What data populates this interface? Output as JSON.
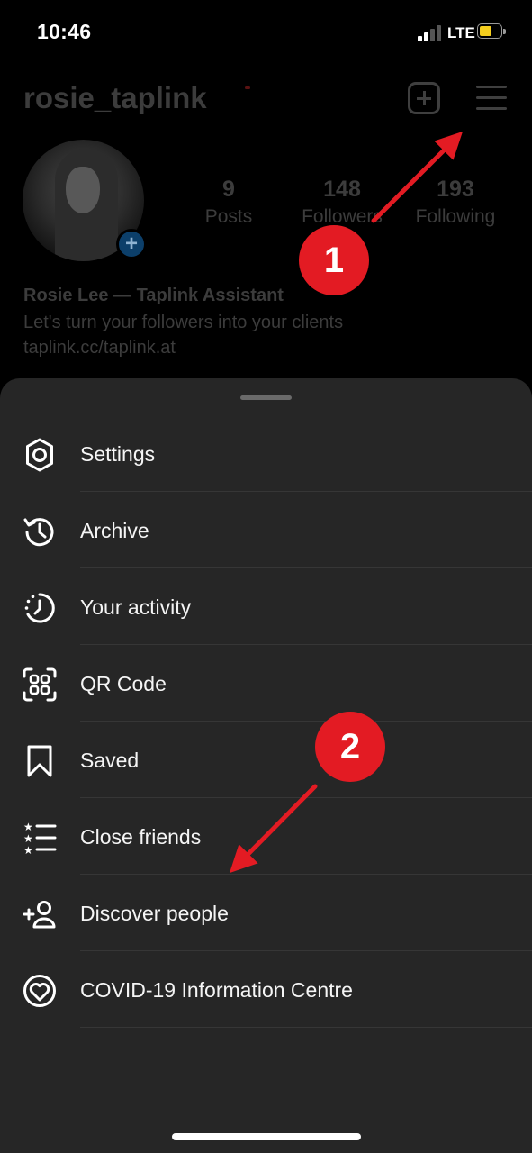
{
  "status_bar": {
    "time": "10:46",
    "network": "LTE",
    "battery_level": 0.6,
    "battery_color": "#f6cf1e"
  },
  "profile": {
    "username": "rosie_taplink",
    "stats": [
      {
        "value": "9",
        "label": "Posts"
      },
      {
        "value": "148",
        "label": "Followers"
      },
      {
        "value": "193",
        "label": "Following"
      }
    ],
    "bio_name": "Rosie Lee — Taplink Assistant",
    "bio_text": "Let's turn your followers into your clients",
    "bio_link": "taplink.cc/taplink.at",
    "header_icons": [
      "add-post-icon",
      "hamburger-menu-icon"
    ]
  },
  "menu": {
    "items": [
      {
        "label": "Settings",
        "icon": "settings-icon"
      },
      {
        "label": "Archive",
        "icon": "archive-icon"
      },
      {
        "label": "Your activity",
        "icon": "activity-icon"
      },
      {
        "label": "QR Code",
        "icon": "qr-code-icon"
      },
      {
        "label": "Saved",
        "icon": "bookmark-icon"
      },
      {
        "label": "Close friends",
        "icon": "close-friends-icon"
      },
      {
        "label": "Discover people",
        "icon": "discover-people-icon"
      },
      {
        "label": "COVID-19 Information Centre",
        "icon": "covid-info-icon"
      }
    ]
  },
  "annotations": {
    "step1": "1",
    "step2": "2",
    "color": "#e31b23"
  },
  "colors": {
    "sheet_background": "#262626",
    "page_background": "#000000",
    "dimmed_text": "#3c3c3c"
  }
}
